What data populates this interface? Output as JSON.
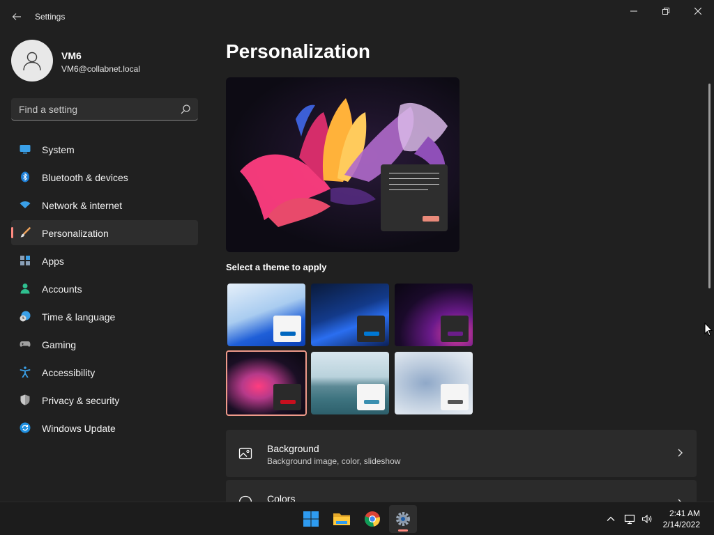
{
  "window": {
    "title": "Settings"
  },
  "profile": {
    "name": "VM6",
    "email": "VM6@collabnet.local"
  },
  "search": {
    "placeholder": "Find a setting"
  },
  "sidebar": {
    "items": [
      {
        "label": "System",
        "icon": "system-icon",
        "active": false
      },
      {
        "label": "Bluetooth & devices",
        "icon": "bluetooth-icon",
        "active": false
      },
      {
        "label": "Network & internet",
        "icon": "wifi-icon",
        "active": false
      },
      {
        "label": "Personalization",
        "icon": "brush-icon",
        "active": true
      },
      {
        "label": "Apps",
        "icon": "apps-icon",
        "active": false
      },
      {
        "label": "Accounts",
        "icon": "accounts-icon",
        "active": false
      },
      {
        "label": "Time & language",
        "icon": "clock-globe-icon",
        "active": false
      },
      {
        "label": "Gaming",
        "icon": "gamepad-icon",
        "active": false
      },
      {
        "label": "Accessibility",
        "icon": "accessibility-icon",
        "active": false
      },
      {
        "label": "Privacy & security",
        "icon": "shield-icon",
        "active": false
      },
      {
        "label": "Windows Update",
        "icon": "update-icon",
        "active": false
      }
    ]
  },
  "main": {
    "title": "Personalization",
    "theme_section_label": "Select a theme to apply",
    "themes": [
      {
        "name": "windows-light",
        "selected": false,
        "accent": "#0067c0"
      },
      {
        "name": "windows-dark",
        "selected": false,
        "accent": "#0078d4"
      },
      {
        "name": "glow",
        "selected": false,
        "accent": "#6b1d8a"
      },
      {
        "name": "captured-motion",
        "selected": true,
        "accent": "#c80f1e"
      },
      {
        "name": "sunrise",
        "selected": false,
        "accent": "#3a8fb0"
      },
      {
        "name": "flow",
        "selected": false,
        "accent": "#555555"
      }
    ],
    "cards": [
      {
        "title": "Background",
        "subtitle": "Background image, color, slideshow",
        "icon": "image-icon"
      },
      {
        "title": "Colors",
        "subtitle": "",
        "icon": "palette-icon"
      }
    ]
  },
  "taskbar": {
    "apps": [
      "start-icon",
      "file-explorer-icon",
      "chrome-icon",
      "settings-icon"
    ],
    "active_app": "settings-icon"
  },
  "tray": {
    "time": "2:41 AM",
    "date": "2/14/2022"
  },
  "colors": {
    "accent": "#ff8a80",
    "background": "#202020",
    "card": "#2b2b2b"
  }
}
